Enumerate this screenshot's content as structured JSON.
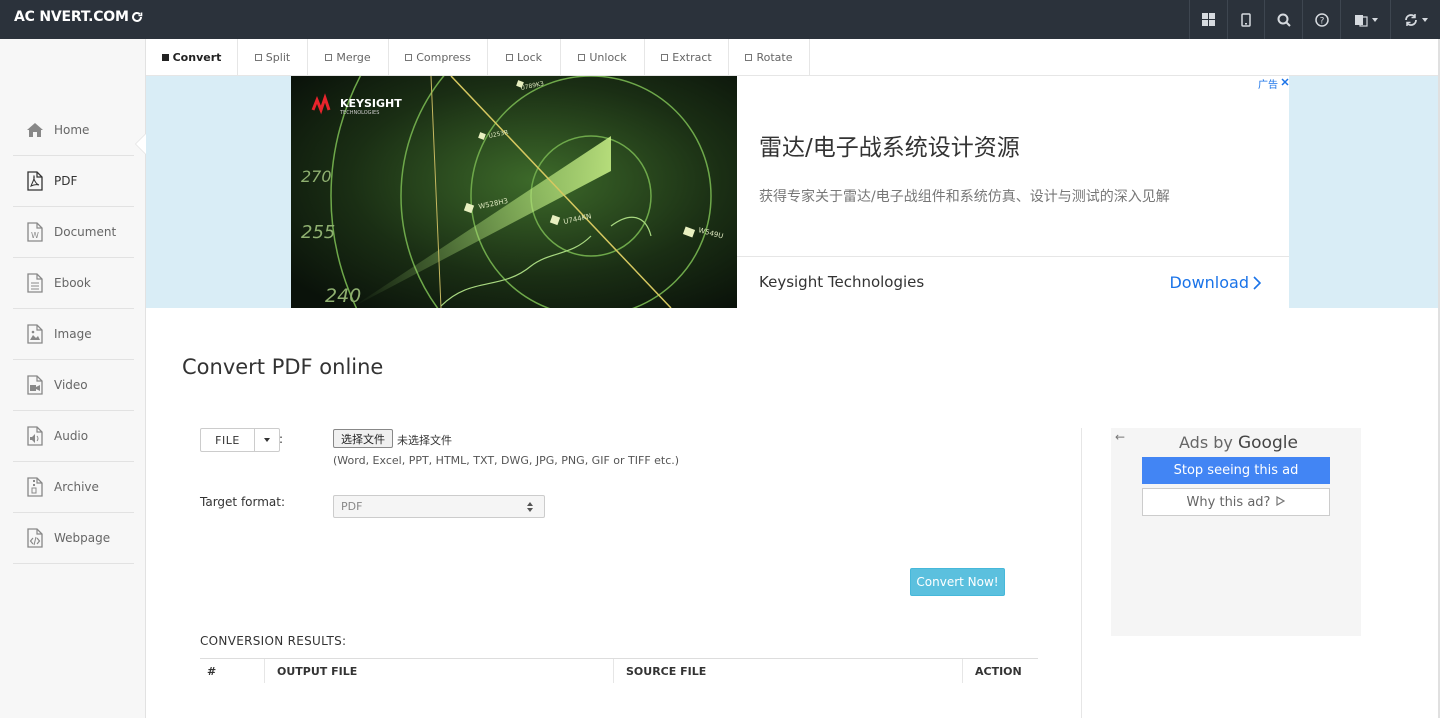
{
  "brand": {
    "name": "AC NVERT.COM"
  },
  "topbar": {
    "icons": [
      "grid-icon",
      "mobile-icon",
      "search-icon",
      "help-icon",
      "language-icon",
      "refresh-icon"
    ]
  },
  "tabs": [
    {
      "label": "Convert",
      "active": true
    },
    {
      "label": "Split",
      "active": false
    },
    {
      "label": "Merge",
      "active": false
    },
    {
      "label": "Compress",
      "active": false
    },
    {
      "label": "Lock",
      "active": false
    },
    {
      "label": "Unlock",
      "active": false
    },
    {
      "label": "Extract",
      "active": false
    },
    {
      "label": "Rotate",
      "active": false
    }
  ],
  "sidebar": {
    "items": [
      {
        "label": "Home",
        "icon": "home-icon"
      },
      {
        "label": "PDF",
        "icon": "pdf-icon",
        "active": true
      },
      {
        "label": "Document",
        "icon": "document-icon"
      },
      {
        "label": "Ebook",
        "icon": "ebook-icon"
      },
      {
        "label": "Image",
        "icon": "image-icon"
      },
      {
        "label": "Video",
        "icon": "video-icon"
      },
      {
        "label": "Audio",
        "icon": "audio-icon"
      },
      {
        "label": "Archive",
        "icon": "archive-icon"
      },
      {
        "label": "Webpage",
        "icon": "webpage-icon"
      }
    ]
  },
  "ad": {
    "brand_logo": "KEYSIGHT",
    "brand_logo_sub": "TECHNOLOGIES",
    "headline": "雷达/电子战系统设计资源",
    "description": "获得专家关于雷达/电子战组件和系统仿真、设计与测试的深入见解",
    "advertiser": "Keysight Technologies",
    "cta": "Download",
    "choice_label": "广告",
    "radar_labels": [
      "U789K3",
      "U253R",
      "W528H3",
      "U744KN",
      "W549U"
    ],
    "radar_numbers": [
      "270",
      "255",
      "240"
    ]
  },
  "main": {
    "title": "Convert PDF online",
    "file_button": "FILE",
    "colon": ":",
    "choose_file": "选择文件",
    "no_file": "未选择文件",
    "file_hint": "(Word, Excel, PPT, HTML, TXT, DWG, JPG, PNG, GIF or TIFF etc.)",
    "target_label": "Target format:",
    "target_value": "PDF",
    "convert_button": "Convert Now!",
    "results_title": "CONVERSION RESULTS:",
    "results_columns": [
      "#",
      "OUTPUT FILE",
      "SOURCE FILE",
      "ACTION"
    ]
  },
  "google_ad": {
    "back": "←",
    "ads_by": "Ads by",
    "google": "Google",
    "stop": "Stop seeing this ad",
    "why": "Why this ad?"
  },
  "colors": {
    "topbar": "#2b323b",
    "accent": "#5bc0de",
    "ad_bg": "#d9edf6",
    "google_blue": "#4285f4"
  }
}
